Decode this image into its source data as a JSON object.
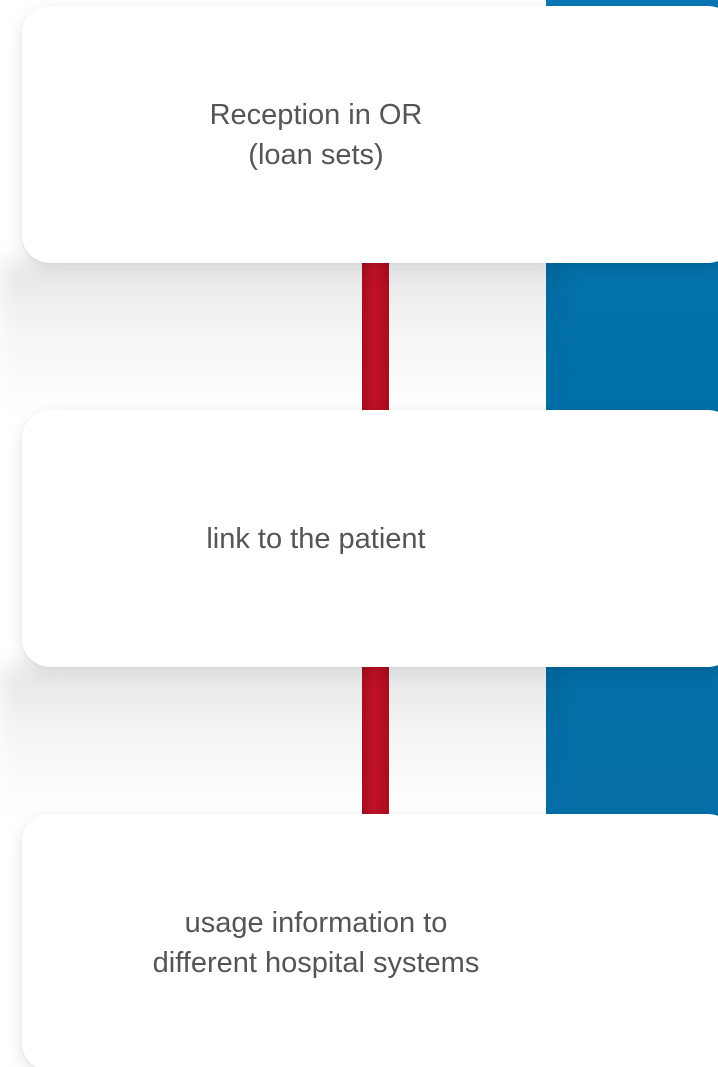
{
  "diagram": {
    "steps": [
      {
        "label": "Reception in OR\n(loan sets)"
      },
      {
        "label": "link to the patient"
      },
      {
        "label": "usage information to\ndifferent hospital systems"
      }
    ]
  },
  "colors": {
    "band": "#0a77b4",
    "connector": "#c21126",
    "card": "#ffffff",
    "text": "#555555"
  }
}
